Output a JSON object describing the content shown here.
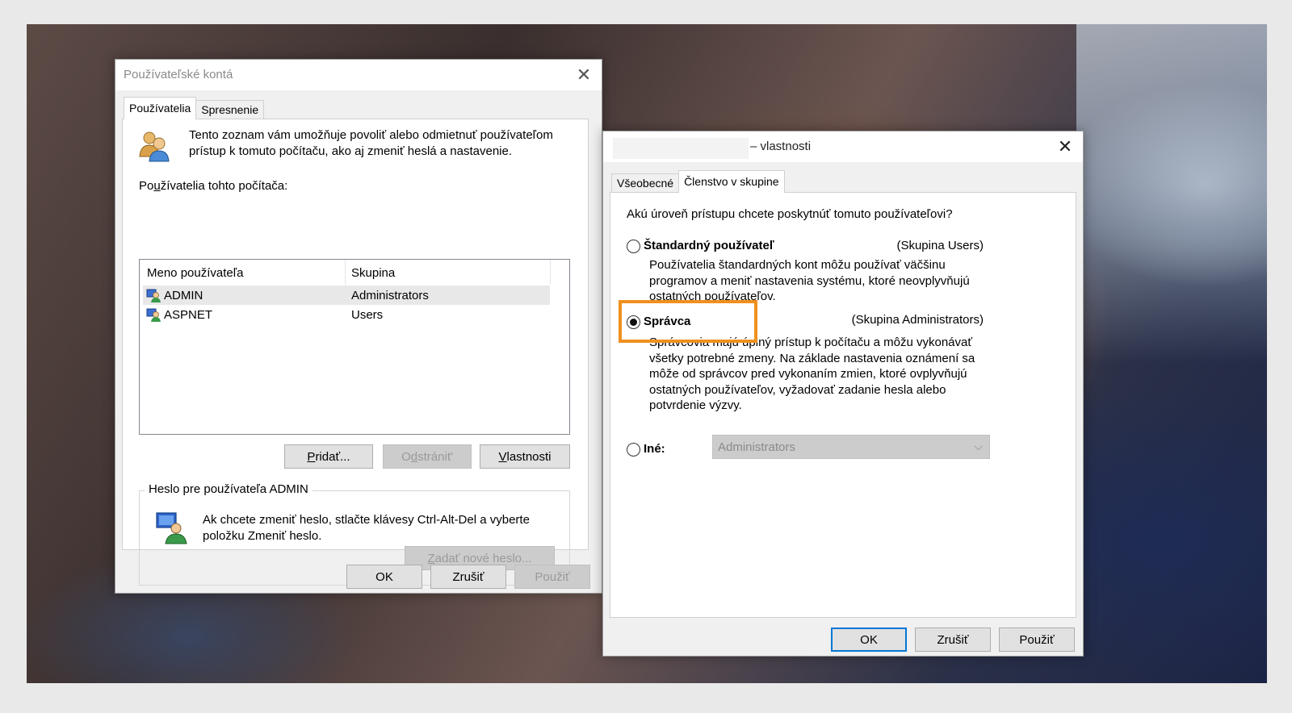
{
  "accounts_window": {
    "title": "Používateľské kontá",
    "tabs": [
      "Používatelia",
      "Spresnenie"
    ],
    "active_tab": "Používatelia",
    "intro_text_line1": "Tento zoznam vám umožňuje povoliť alebo odmietnuť používateľom",
    "intro_text_line2": "prístup k tomuto počítaču, ako aj zmeniť heslá a nastavenie.",
    "users_label_pre": "Po",
    "users_label_u": "u",
    "users_label_post": "žívatelia tohto počítača:",
    "columns": [
      "Meno používateľa",
      "Skupina"
    ],
    "users": [
      {
        "name": "ADMIN",
        "group": "Administrators",
        "selected": true
      },
      {
        "name": "ASPNET",
        "group": "Users",
        "selected": false
      }
    ],
    "buttons": {
      "add_u": "P",
      "add_rest": "ridať...",
      "remove_pre": "O",
      "remove_u": "d",
      "remove_rest": "stránit'",
      "properties_u": "V",
      "properties_rest": "lastnosti"
    },
    "password_group": {
      "legend": "Heslo pre používateľa ADMIN",
      "text_line1": "Ak chcete zmeniť heslo, stlačte klávesy Ctrl-Alt-Del a vyberte",
      "text_line2": "položku Zmeniť heslo.",
      "reset_button_u": "Z",
      "reset_button_rest": "adať nové heslo..."
    },
    "footer": {
      "ok": "OK",
      "cancel": "Zrušiť",
      "apply": "Použiť"
    }
  },
  "properties_window": {
    "title_suffix": "– vlastnosti",
    "tabs": [
      "Všeobecné",
      "Členstvo v skupine"
    ],
    "active_tab": "Členstvo v skupine",
    "question": "Akú úroveň prístupu chcete poskytnúť tomuto používateľovi?",
    "options": [
      {
        "label": "Štandardný používateľ",
        "group": "(Skupina Users)",
        "checked": false,
        "desc": [
          "Používatelia štandardných kont môžu používať väčšinu",
          "programov a meniť nastavenia systému, ktoré neovplyvňujú",
          "ostatných používateľov."
        ]
      },
      {
        "label": "Správca",
        "group": "(Skupina Administrators)",
        "checked": true,
        "desc": [
          "Správcovia majú úplný prístup k počítaču a môžu vykonávať",
          "všetky potrebné zmeny. Na základe nastavenia oznámení sa",
          "môže od správcov pred vykonaním zmien, ktoré ovplyvňujú",
          "ostatných používateľov, vyžadovať zadanie hesla alebo",
          "potvrdenie výzvy."
        ]
      }
    ],
    "other_label": "Iné:",
    "other_select_value": "Administrators",
    "footer": {
      "ok": "OK",
      "cancel": "Zrušiť",
      "apply": "Použiť"
    }
  },
  "colors": {
    "highlight": "#f0901e",
    "default_button_border": "#0078d7"
  }
}
